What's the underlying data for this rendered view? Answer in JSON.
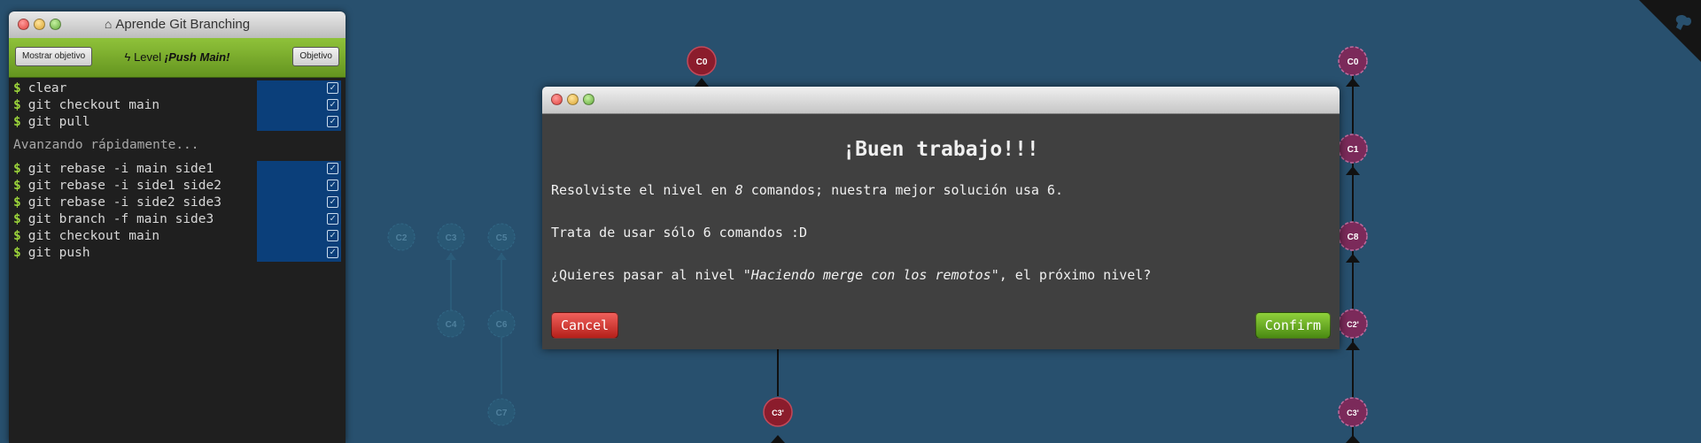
{
  "terminal": {
    "title": "Aprende Git Branching",
    "show_goal_label": "Mostrar objetivo",
    "level_prefix": "Level",
    "level_name": "¡Push Main!",
    "goal_label": "Objetivo",
    "commands_a": [
      "clear",
      "git checkout main",
      "git pull"
    ],
    "fast_forward_note": "Avanzando rápidamente...",
    "commands_b": [
      "git rebase -i main side1",
      "git rebase -i side1 side2",
      "git rebase -i side2 side3",
      "git branch -f main side3",
      "git checkout main",
      "git push"
    ]
  },
  "graph": {
    "left_nodes": [
      "C0",
      "C3'"
    ],
    "faded_nodes": [
      "C2",
      "C3",
      "C5",
      "C4",
      "C6",
      "C7"
    ],
    "right_nodes": [
      "C0",
      "C1",
      "C8",
      "C2'",
      "C3'"
    ]
  },
  "modal": {
    "heading": "¡Buen trabajo!!!",
    "line1_before": "Resolviste el nivel en ",
    "line1_count": "8",
    "line1_after": " comandos; nuestra mejor solución usa 6.",
    "line2": "Trata de usar sólo 6 comandos :D",
    "line3_before": "¿Quieres pasar al nivel ",
    "line3_level": "\"Haciendo merge con los remotos\"",
    "line3_after": ", el próximo nivel?",
    "cancel_label": "Cancel",
    "confirm_label": "Confirm"
  },
  "colors": {
    "background": "#28506e",
    "local_commit": "#8b1c2c",
    "remote_commit": "#7b2a5a",
    "faded_commit": "#2d6a86",
    "accent_green": "#9bd33a"
  },
  "icons": [
    "home-icon",
    "bolt-icon",
    "checkbox-icon",
    "octocat-icon"
  ]
}
